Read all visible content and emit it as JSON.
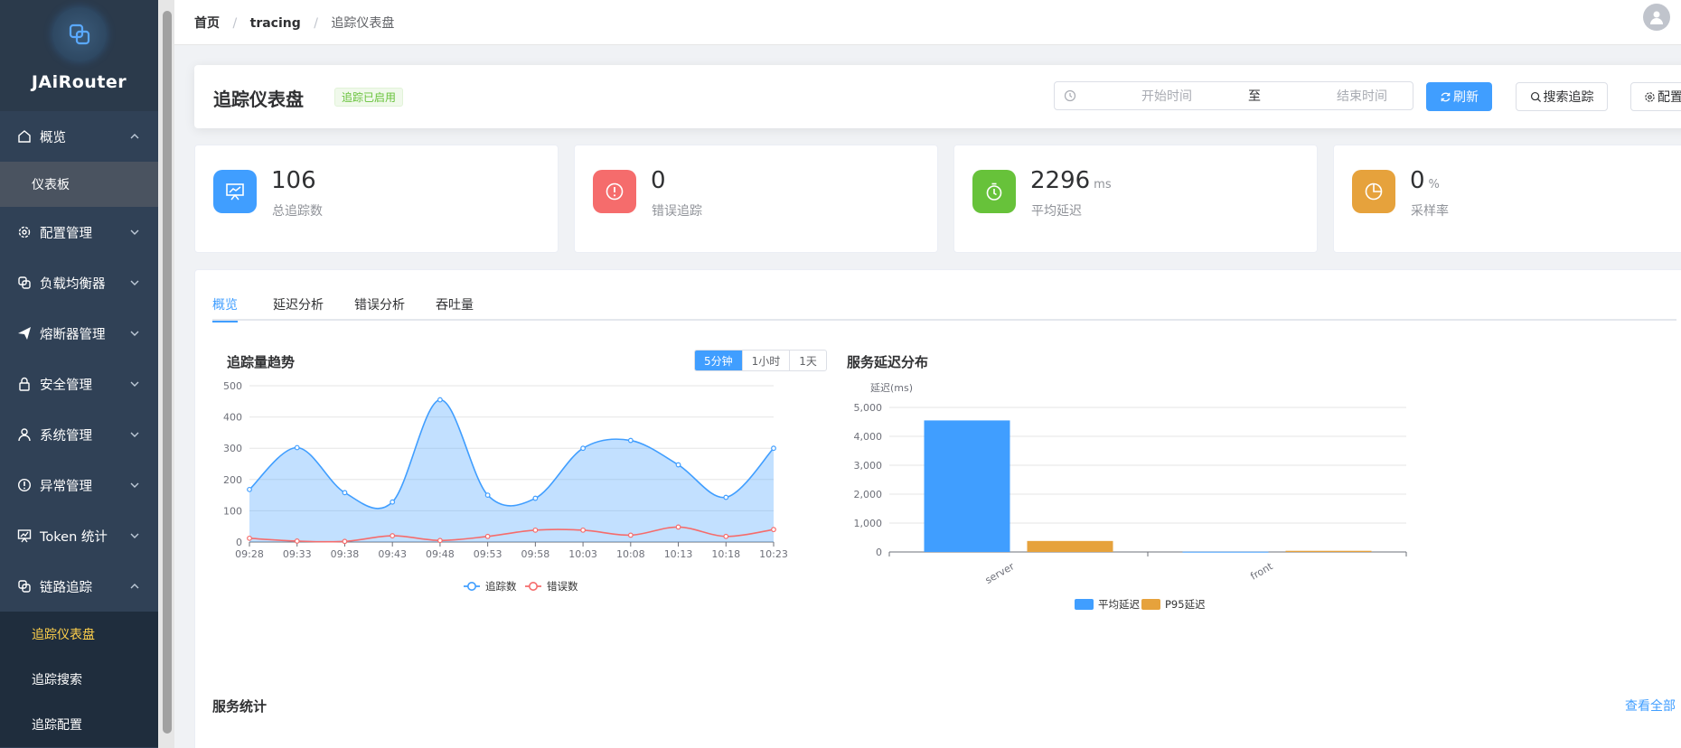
{
  "brand": {
    "name": "JAiRouter"
  },
  "sidebar": {
    "items": [
      {
        "label": "概览",
        "icon": "home-icon"
      },
      {
        "label": "仪表板",
        "sub": true
      },
      {
        "label": "配置管理",
        "icon": "gear-icon"
      },
      {
        "label": "负载均衡器",
        "icon": "link-icon"
      },
      {
        "label": "熔断器管理",
        "icon": "send-icon"
      },
      {
        "label": "安全管理",
        "icon": "lock-icon"
      },
      {
        "label": "系统管理",
        "icon": "user-icon"
      },
      {
        "label": "异常管理",
        "icon": "warning-icon"
      },
      {
        "label": "Token 统计",
        "icon": "chart-icon"
      },
      {
        "label": "链路追踪",
        "icon": "link-icon"
      },
      {
        "label": "追踪仪表盘",
        "sub": true
      },
      {
        "label": "追踪搜索",
        "sub": true
      },
      {
        "label": "追踪配置",
        "sub": true
      }
    ]
  },
  "breadcrumb": {
    "home": "首页",
    "section": "tracing",
    "page": "追踪仪表盘"
  },
  "header": {
    "title": "追踪仪表盘",
    "status": "追踪已启用",
    "start_placeholder": "开始时间",
    "range_sep": "至",
    "end_placeholder": "结束时间",
    "refresh": "刷新",
    "search": "搜索追踪",
    "config": "配置"
  },
  "stats": [
    {
      "value": "106",
      "unit": "",
      "label": "总追踪数",
      "color": "#409eff",
      "icon": "presentation-icon"
    },
    {
      "value": "0",
      "unit": "",
      "label": "错误追踪",
      "color": "#f56c6c",
      "icon": "alert-icon"
    },
    {
      "value": "2296",
      "unit": "ms",
      "label": "平均延迟",
      "color": "#67c23a",
      "icon": "timer-icon"
    },
    {
      "value": "0",
      "unit": "%",
      "label": "采样率",
      "color": "#e6a23c",
      "icon": "pie-icon"
    }
  ],
  "tabs": [
    "概览",
    "延迟分析",
    "错误分析",
    "吞吐量"
  ],
  "trend": {
    "title": "追踪量趋势",
    "ranges": [
      "5分钟",
      "1小时",
      "1天"
    ]
  },
  "latency": {
    "title": "服务延迟分布"
  },
  "services": {
    "title": "服务统计",
    "view_all": "查看全部"
  },
  "colors": {
    "primary": "#409eff",
    "danger": "#f56c6c",
    "warning": "#e6a23c",
    "success": "#67c23a"
  },
  "chart_data": [
    {
      "type": "area",
      "title": "追踪量趋势",
      "x": [
        "09:28",
        "09:33",
        "09:38",
        "09:43",
        "09:48",
        "09:53",
        "09:58",
        "10:03",
        "10:08",
        "10:13",
        "10:18",
        "10:23"
      ],
      "ylim": [
        0,
        500
      ],
      "yticks": [
        0,
        100,
        200,
        300,
        400,
        500
      ],
      "series": [
        {
          "name": "追踪数",
          "values": [
            168,
            302,
            158,
            128,
            455,
            150,
            140,
            300,
            325,
            247,
            143,
            300
          ],
          "color": "#409eff"
        },
        {
          "name": "错误数",
          "values": [
            12,
            3,
            2,
            20,
            5,
            18,
            38,
            38,
            22,
            48,
            18,
            40
          ],
          "color": "#f56c6c"
        }
      ],
      "grid": true,
      "legend": "bottom"
    },
    {
      "type": "bar",
      "title": "服务延迟分布",
      "ylabel": "延迟(ms)",
      "categories": [
        "server",
        "front"
      ],
      "ylim": [
        0,
        5000
      ],
      "yticks": [
        "0",
        "1,000",
        "2,000",
        "3,000",
        "4,000",
        "5,000"
      ],
      "series": [
        {
          "name": "平均延迟",
          "values": [
            4550,
            10
          ],
          "color": "#409eff"
        },
        {
          "name": "P95延迟",
          "values": [
            380,
            40
          ],
          "color": "#e6a23c"
        }
      ],
      "grid": true,
      "legend": "bottom"
    }
  ]
}
